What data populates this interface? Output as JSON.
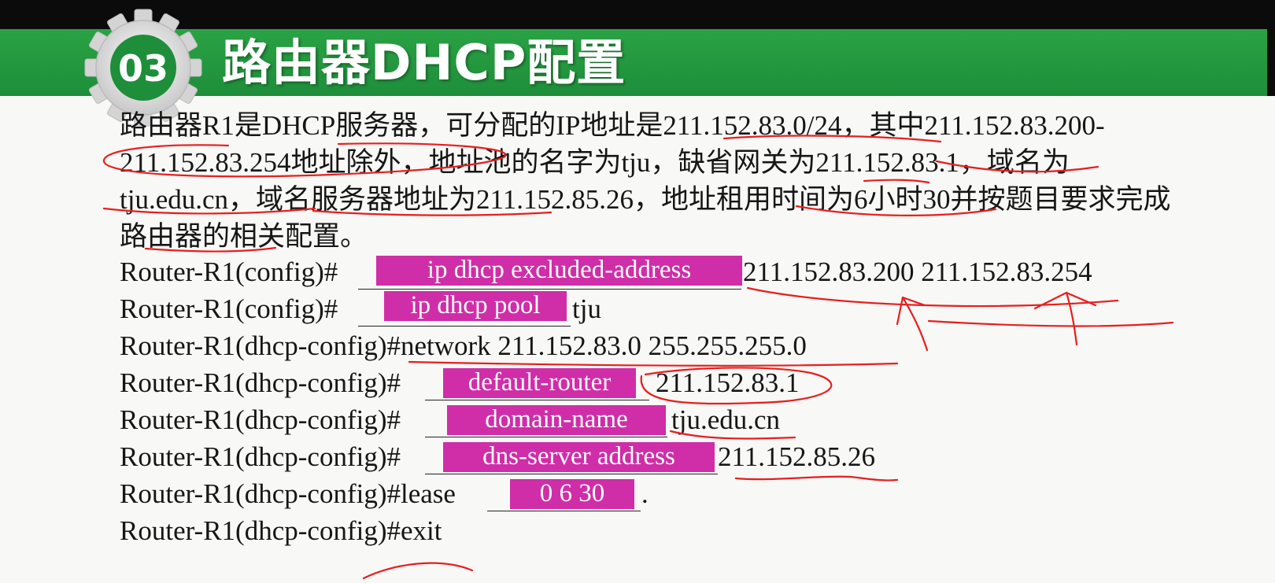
{
  "slide": {
    "number": "03",
    "title": "路由器DHCP配置"
  },
  "question": "路由器R1是DHCP服务器，可分配的IP地址是211.152.83.0/24，其中211.152.83.200-211.152.83.254地址除外，地址池的名字为tju，缺省网关为211.152.83.1，域名为tju.edu.cn，域名服务器地址为211.152.85.26，地址租用时间为6小时30并按题目要求完成路由器的相关配置。",
  "commands": [
    {
      "prompt": "Router-R1(config)#",
      "answer": "ip dhcp excluded-address",
      "suffix": "211.152.83.200  211.152.83.254"
    },
    {
      "prompt": "Router-R1(config)#",
      "answer": "ip dhcp pool",
      "suffix": "tju"
    },
    {
      "prompt": "Router-R1(dhcp-config)#network  211.152.83.0 255.255.255.0"
    },
    {
      "prompt": "Router-R1(dhcp-config)#",
      "answer": "default-router",
      "suffix": "211.152.83.1"
    },
    {
      "prompt": "Router-R1(dhcp-config)#",
      "answer": "domain-name",
      "suffix": "tju.edu.cn"
    },
    {
      "prompt": "Router-R1(dhcp-config)#",
      "answer": "dns-server  address",
      "suffix": "211.152.85.26"
    },
    {
      "prompt": "Router-R1(dhcp-config)#lease",
      "answer": "0 6 30",
      "suffix": "."
    },
    {
      "prompt": "Router-R1(dhcp-config)#exit"
    }
  ],
  "colors": {
    "banner": "#1e8e3a",
    "answer_highlight": "#cf2ea8",
    "annotation_ink": "#e81e1e"
  }
}
